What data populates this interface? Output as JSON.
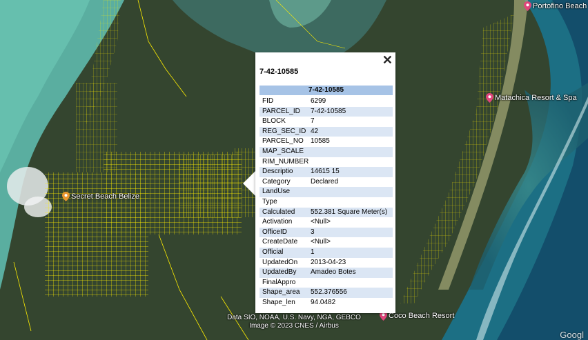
{
  "popup": {
    "title": "7-42-10585",
    "header": "7-42-10585",
    "close_icon": "close-icon",
    "rows": [
      {
        "key": "FID",
        "value": "6299"
      },
      {
        "key": "PARCEL_ID",
        "value": "7-42-10585"
      },
      {
        "key": "BLOCK",
        "value": "7"
      },
      {
        "key": "REG_SEC_ID",
        "value": "42"
      },
      {
        "key": "PARCEL_NO",
        "value": "10585"
      },
      {
        "key": "MAP_SCALE",
        "value": ""
      },
      {
        "key": "RIM_NUMBER",
        "value": ""
      },
      {
        "key": "Descriptio",
        "value": "14615 15"
      },
      {
        "key": "Category",
        "value": "Declared"
      },
      {
        "key": "LandUse",
        "value": ""
      },
      {
        "key": "Type",
        "value": ""
      },
      {
        "key": "Calculated",
        "value": "552.381 Square Meter(s)"
      },
      {
        "key": "Activation",
        "value": "<Null>"
      },
      {
        "key": "OfficeID",
        "value": "3"
      },
      {
        "key": "CreateDate",
        "value": "<Null>"
      },
      {
        "key": "Official",
        "value": "1"
      },
      {
        "key": "UpdatedOn",
        "value": "2013-04-23"
      },
      {
        "key": "UpdatedBy",
        "value": "Amadeo Botes"
      },
      {
        "key": "FinalAppro",
        "value": ""
      },
      {
        "key": "Shape_area",
        "value": "552.376556"
      },
      {
        "key": "Shape_len",
        "value": "94.0482"
      }
    ]
  },
  "places": {
    "secret_beach": "Secret Beach Belize",
    "portofino": "Portofino Beach",
    "matachica": "Matachica Resort & Spa",
    "coco_beach": "Coco Beach Resort"
  },
  "attribution": {
    "line1": "Data SIO, NOAA, U.S. Navy, NGA, GEBCO",
    "line2": "Image © 2023 CNES / Airbus",
    "corner": "Googl"
  },
  "colors": {
    "parcel_lines": "#ffee00",
    "pin_orange": "#e9962e",
    "pin_pink": "#e0457b",
    "popup_header": "#a6c3e6"
  }
}
